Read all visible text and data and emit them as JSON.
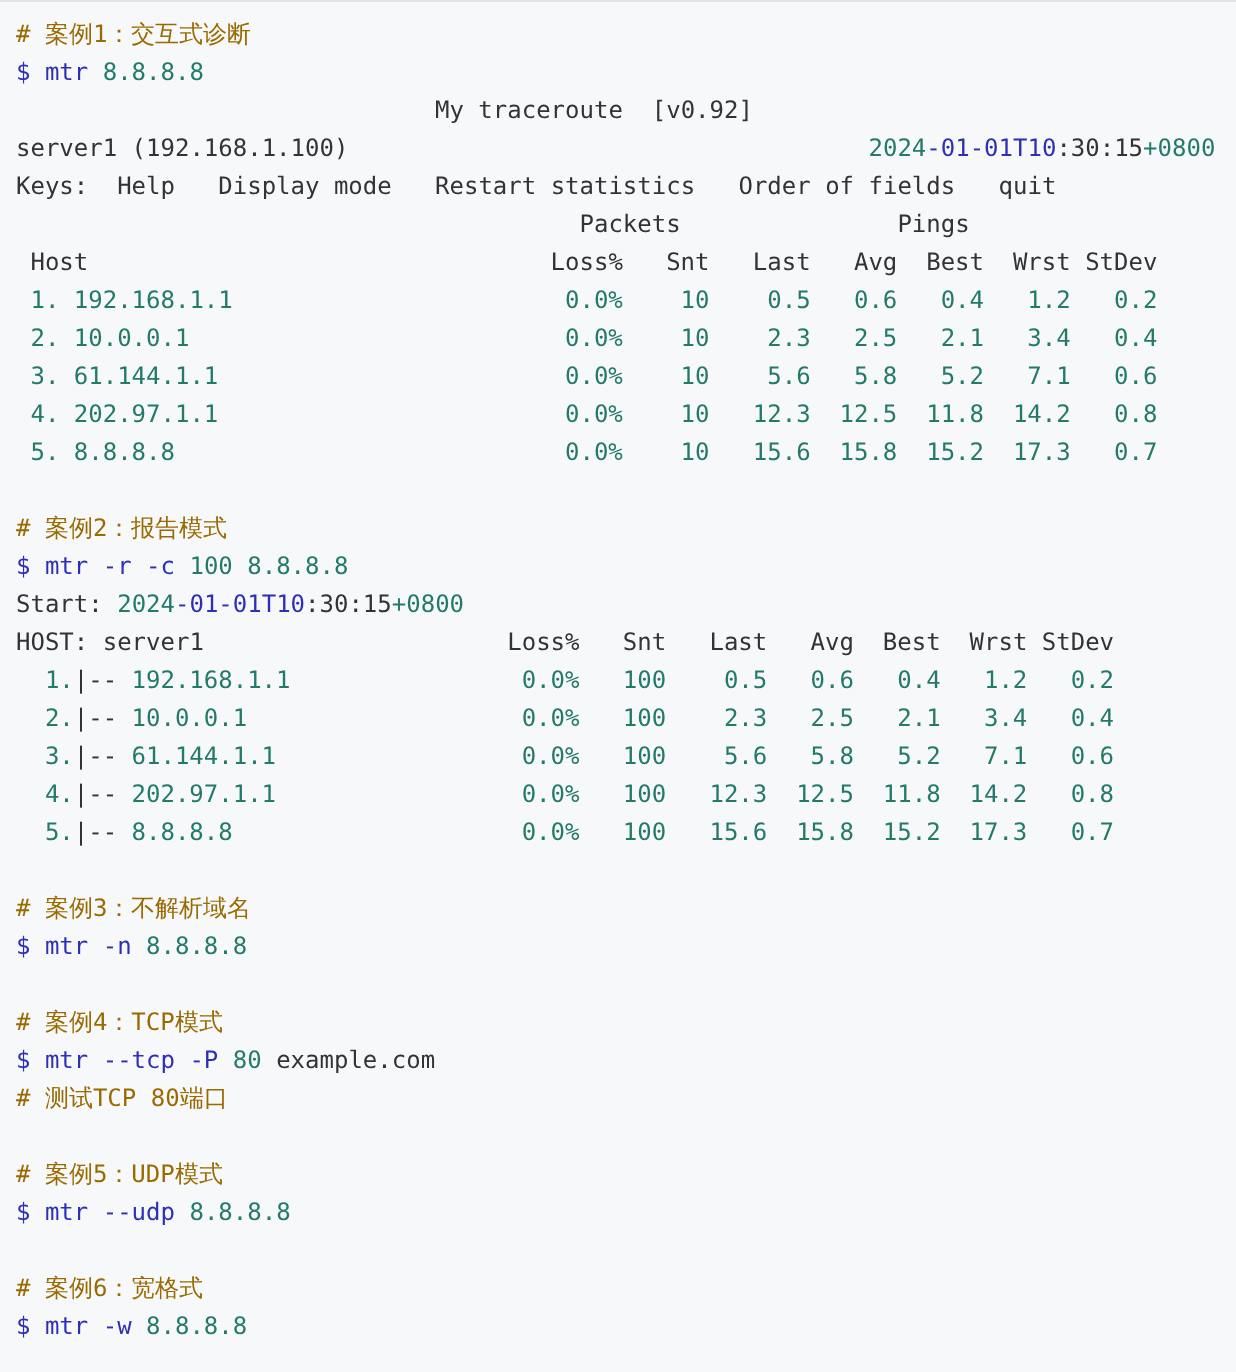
{
  "blocks": [
    {
      "kind": "comment",
      "text": "# 案例1：交互式诊断"
    },
    {
      "kind": "command",
      "tokens": [
        {
          "kind": "keyword",
          "text": "$ mtr"
        },
        {
          "kind": "number",
          "text": "8.8.8.8"
        }
      ]
    },
    {
      "kind": "title",
      "text": "My traceroute  [v0.92]"
    },
    {
      "kind": "status",
      "left": "server1 (192.168.1.100)",
      "right": [
        {
          "kind": "number",
          "text": "2024"
        },
        {
          "kind": "keyword",
          "text": "-01-01T10"
        },
        {
          "kind": "plain",
          "text": ":30:15"
        },
        {
          "kind": "number",
          "text": "+0800"
        }
      ]
    },
    {
      "kind": "keys",
      "label": "Keys:",
      "items": [
        "Help",
        "Display mode",
        "Restart statistics",
        "Order of fields",
        "quit"
      ]
    },
    {
      "kind": "live-table",
      "groups": [
        "Packets",
        "Pings"
      ],
      "columns": [
        "Host",
        "Loss%",
        "Snt",
        "Last",
        "Avg",
        "Best",
        "Wrst",
        "StDev"
      ],
      "rows": [
        {
          "hop": "1.",
          "host": "192.168.1.1",
          "values": [
            "0.0%",
            "10",
            "0.5",
            "0.6",
            "0.4",
            "1.2",
            "0.2"
          ]
        },
        {
          "hop": "2.",
          "host": "10.0.0.1",
          "values": [
            "0.0%",
            "10",
            "2.3",
            "2.5",
            "2.1",
            "3.4",
            "0.4"
          ]
        },
        {
          "hop": "3.",
          "host": "61.144.1.1",
          "values": [
            "0.0%",
            "10",
            "5.6",
            "5.8",
            "5.2",
            "7.1",
            "0.6"
          ]
        },
        {
          "hop": "4.",
          "host": "202.97.1.1",
          "values": [
            "0.0%",
            "10",
            "12.3",
            "12.5",
            "11.8",
            "14.2",
            "0.8"
          ]
        },
        {
          "hop": "5.",
          "host": "8.8.8.8",
          "values": [
            "0.0%",
            "10",
            "15.6",
            "15.8",
            "15.2",
            "17.3",
            "0.7"
          ]
        }
      ]
    },
    {
      "kind": "blank"
    },
    {
      "kind": "comment",
      "text": "# 案例2：报告模式"
    },
    {
      "kind": "command",
      "tokens": [
        {
          "kind": "keyword",
          "text": "$ mtr -r -c"
        },
        {
          "kind": "number",
          "text": "100 8.8.8.8"
        }
      ]
    },
    {
      "kind": "command",
      "tokens": [
        {
          "kind": "plain",
          "text": "Start:"
        },
        {
          "kind": "timestamp",
          "parts": [
            {
              "kind": "number",
              "text": "2024"
            },
            {
              "kind": "keyword",
              "text": "-01-01T10"
            },
            {
              "kind": "plain",
              "text": ":30:15"
            },
            {
              "kind": "number",
              "text": "+0800"
            }
          ]
        }
      ]
    },
    {
      "kind": "report-table",
      "columns": [
        "HOST: server1",
        "Loss%",
        "Snt",
        "Last",
        "Avg",
        "Best",
        "Wrst",
        "StDev"
      ],
      "rows": [
        {
          "hop": "1.",
          "branch": "|--",
          "host": "192.168.1.1",
          "values": [
            "0.0%",
            "100",
            "0.5",
            "0.6",
            "0.4",
            "1.2",
            "0.2"
          ]
        },
        {
          "hop": "2.",
          "branch": "|--",
          "host": "10.0.0.1",
          "values": [
            "0.0%",
            "100",
            "2.3",
            "2.5",
            "2.1",
            "3.4",
            "0.4"
          ]
        },
        {
          "hop": "3.",
          "branch": "|--",
          "host": "61.144.1.1",
          "values": [
            "0.0%",
            "100",
            "5.6",
            "5.8",
            "5.2",
            "7.1",
            "0.6"
          ]
        },
        {
          "hop": "4.",
          "branch": "|--",
          "host": "202.97.1.1",
          "values": [
            "0.0%",
            "100",
            "12.3",
            "12.5",
            "11.8",
            "14.2",
            "0.8"
          ]
        },
        {
          "hop": "5.",
          "branch": "|--",
          "host": "8.8.8.8",
          "values": [
            "0.0%",
            "100",
            "15.6",
            "15.8",
            "15.2",
            "17.3",
            "0.7"
          ]
        }
      ]
    },
    {
      "kind": "blank"
    },
    {
      "kind": "comment",
      "text": "# 案例3：不解析域名"
    },
    {
      "kind": "command",
      "tokens": [
        {
          "kind": "keyword",
          "text": "$ mtr -n"
        },
        {
          "kind": "number",
          "text": "8.8.8.8"
        }
      ]
    },
    {
      "kind": "blank"
    },
    {
      "kind": "comment",
      "text": "# 案例4：TCP模式"
    },
    {
      "kind": "command",
      "tokens": [
        {
          "kind": "keyword",
          "text": "$ mtr --tcp -P"
        },
        {
          "kind": "number",
          "text": "80"
        },
        {
          "kind": "plain",
          "text": "example.com"
        }
      ]
    },
    {
      "kind": "comment",
      "text": "# 测试TCP 80端口"
    },
    {
      "kind": "blank"
    },
    {
      "kind": "comment",
      "text": "# 案例5：UDP模式"
    },
    {
      "kind": "command",
      "tokens": [
        {
          "kind": "keyword",
          "text": "$ mtr --udp"
        },
        {
          "kind": "number",
          "text": "8.8.8.8"
        }
      ]
    },
    {
      "kind": "blank"
    },
    {
      "kind": "comment",
      "text": "# 案例6：宽格式"
    },
    {
      "kind": "command",
      "tokens": [
        {
          "kind": "keyword",
          "text": "$ mtr -w"
        },
        {
          "kind": "number",
          "text": "8.8.8.8"
        }
      ]
    }
  ]
}
